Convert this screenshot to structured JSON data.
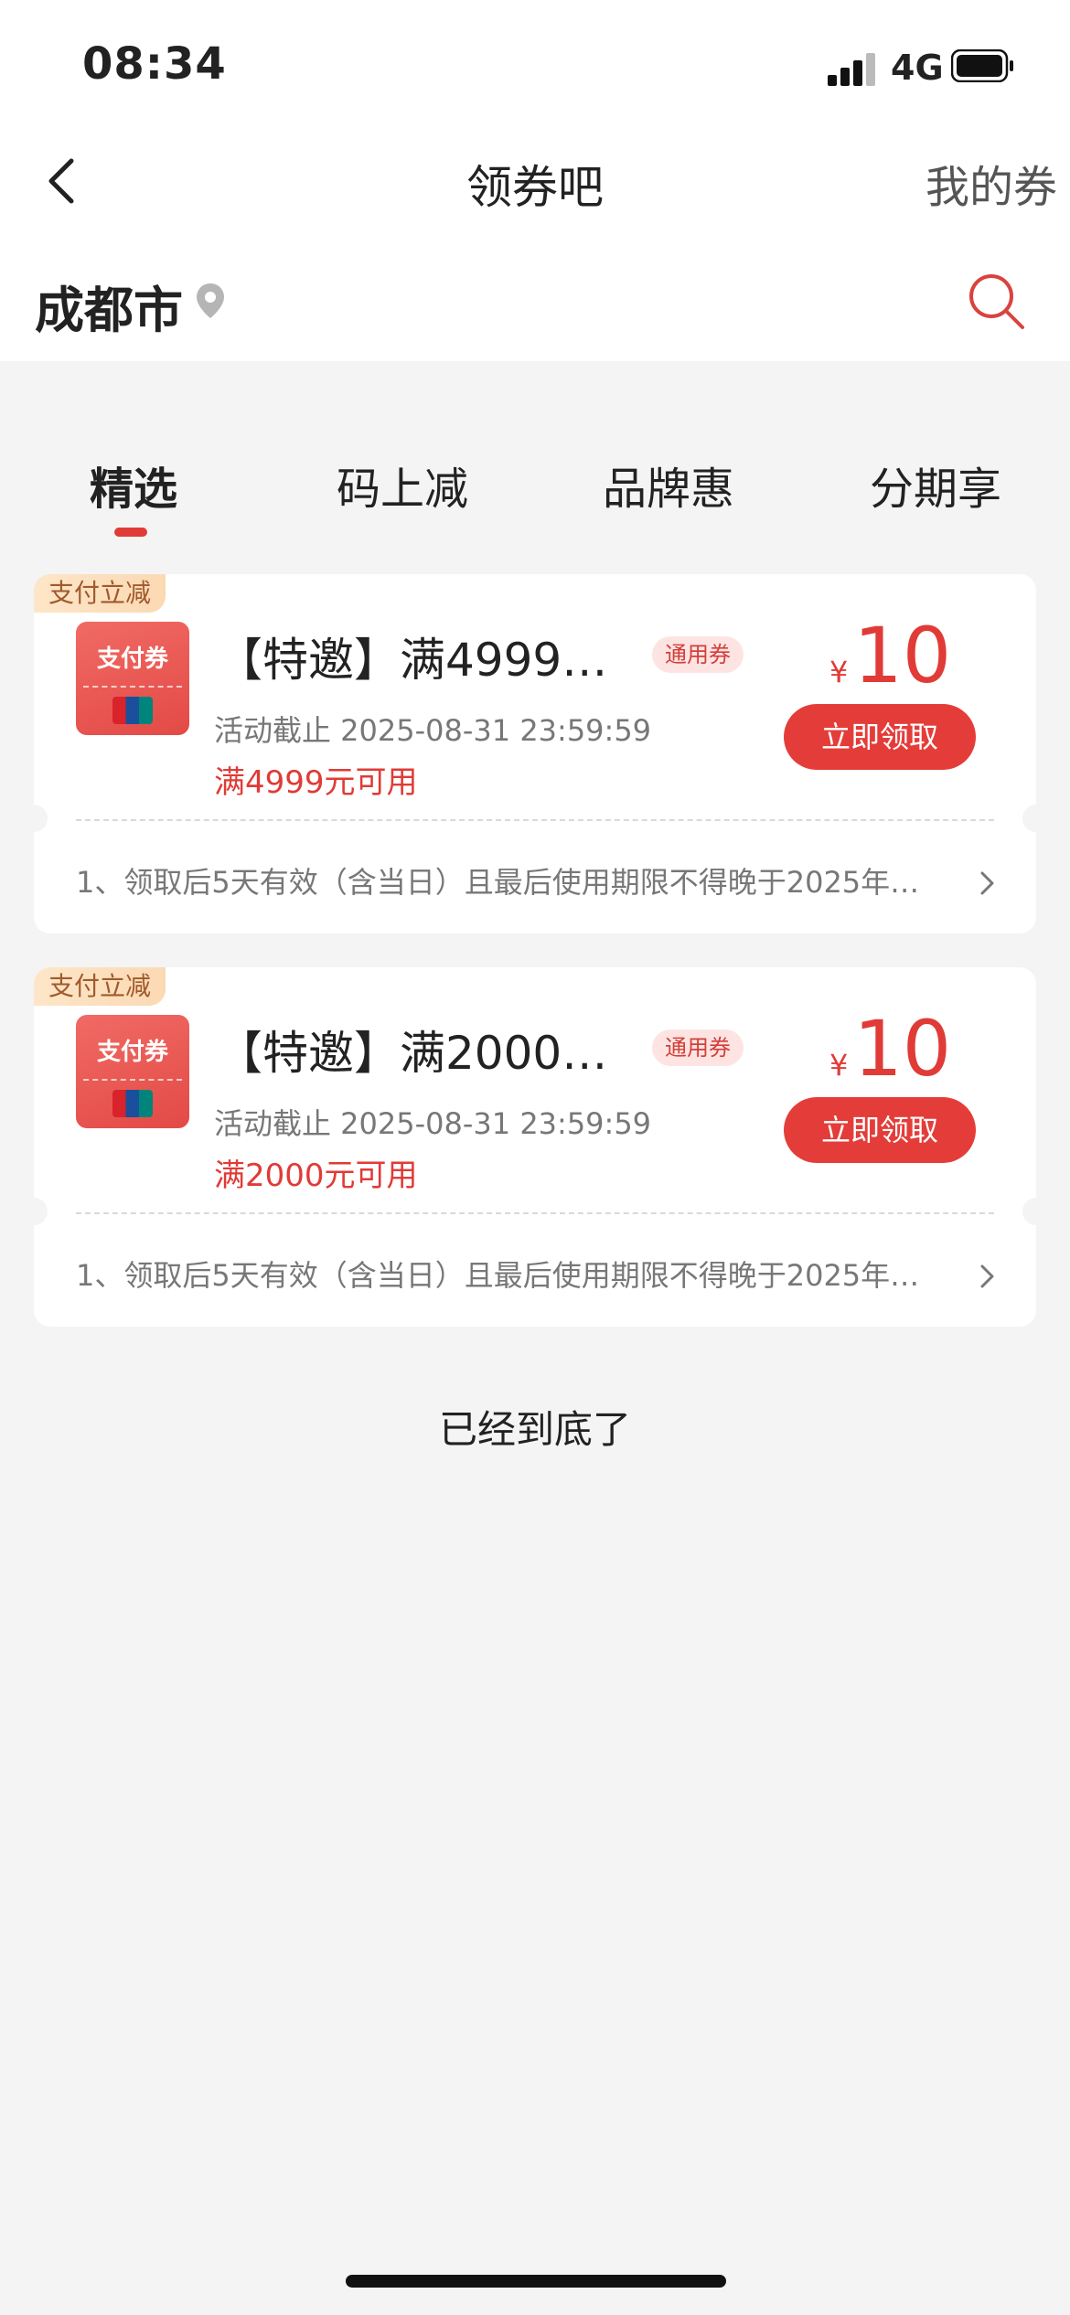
{
  "status_bar": {
    "time": "08:34",
    "network": "4G"
  },
  "nav": {
    "title": "领券吧",
    "right_label": "我的券"
  },
  "location": {
    "city": "成都市"
  },
  "tabs": [
    {
      "label": "精选",
      "active": true
    },
    {
      "label": "码上减",
      "active": false
    },
    {
      "label": "品牌惠",
      "active": false
    },
    {
      "label": "分期享",
      "active": false
    }
  ],
  "coupons": [
    {
      "tag": "支付立减",
      "image_label": "支付券",
      "title": "【特邀】满4999…",
      "badge": "通用券",
      "deadline": "活动截止 2025-08-31 23:59:59",
      "condition": "满4999元可用",
      "currency": "¥",
      "amount": "10",
      "button": "立即领取",
      "rule": "1、领取后5天有效（含当日）且最后使用期限不得晚于2025年…"
    },
    {
      "tag": "支付立减",
      "image_label": "支付券",
      "title": "【特邀】满2000…",
      "badge": "通用券",
      "deadline": "活动截止 2025-08-31 23:59:59",
      "condition": "满2000元可用",
      "currency": "¥",
      "amount": "10",
      "button": "立即领取",
      "rule": "1、领取后5天有效（含当日）且最后使用期限不得晚于2025年…"
    }
  ],
  "end_text": "已经到底了",
  "colors": {
    "accent": "#e03b37",
    "background": "#f4f4f4"
  }
}
